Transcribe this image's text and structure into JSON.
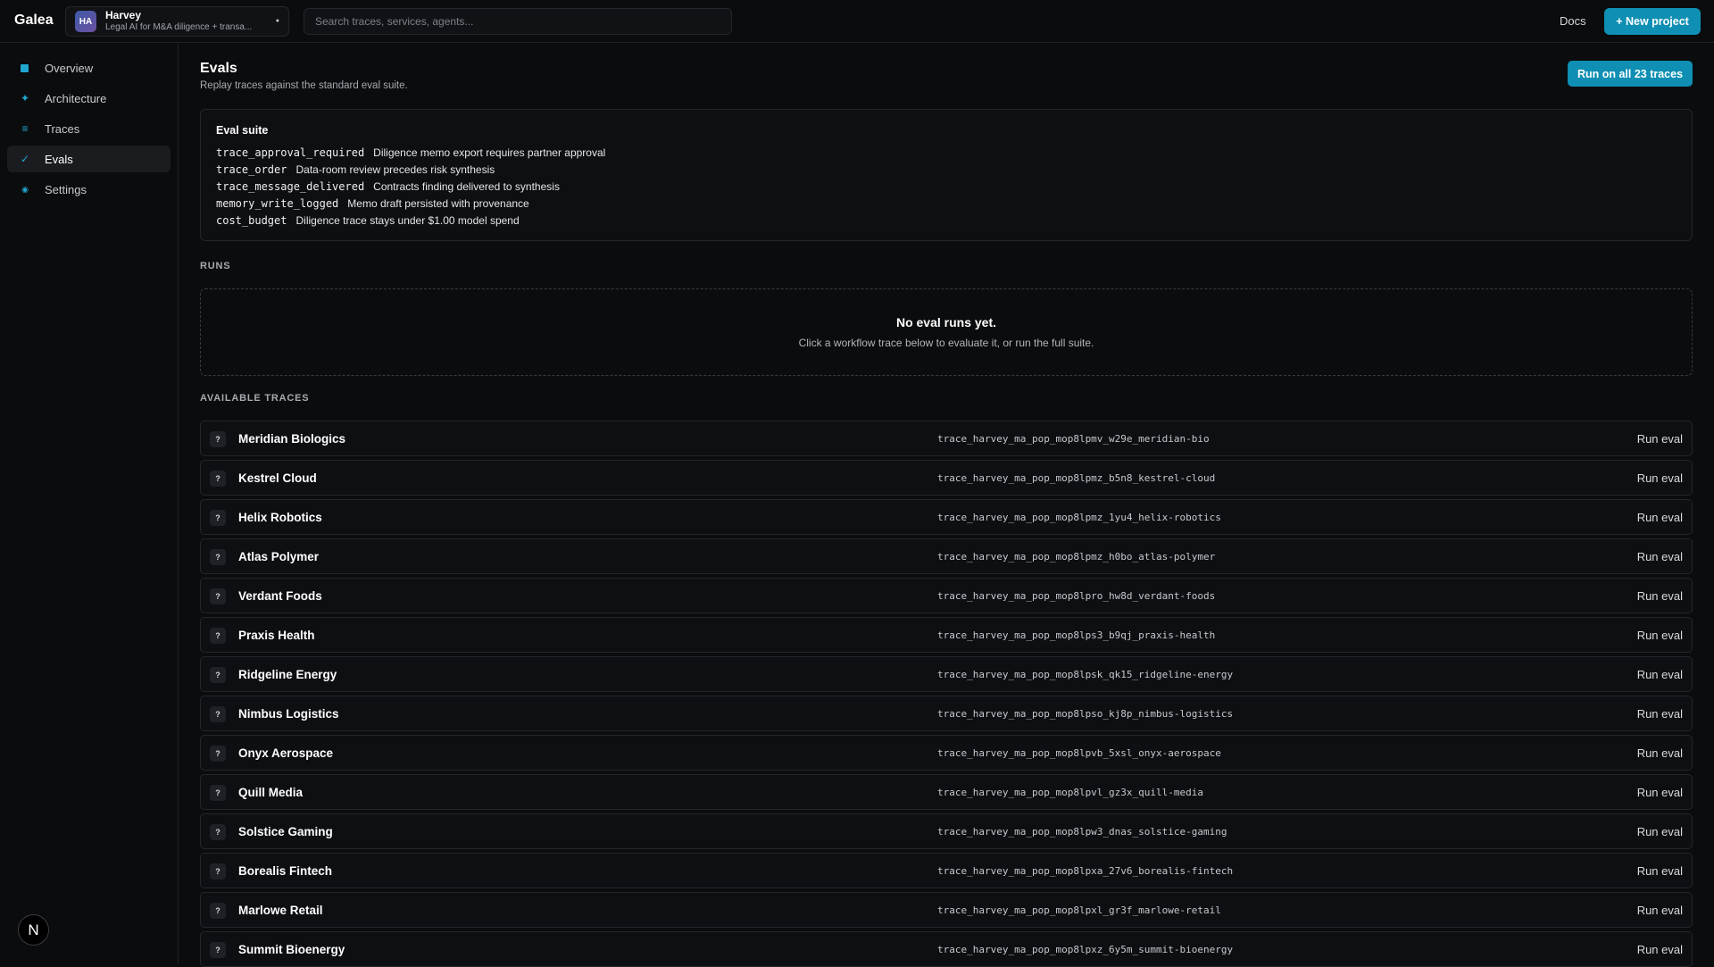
{
  "app": {
    "brand": "Galea"
  },
  "project": {
    "initials": "HA",
    "name": "Harvey",
    "description": "Legal AI for M&A diligence + transa..."
  },
  "search": {
    "placeholder": "Search traces, services, agents..."
  },
  "header": {
    "docs_label": "Docs",
    "new_project_label": "+ New project"
  },
  "sidebar": {
    "items": [
      {
        "label": "Overview",
        "icon": "square-icon"
      },
      {
        "label": "Architecture",
        "icon": "sparkle-icon"
      },
      {
        "label": "Traces",
        "icon": "list-icon"
      },
      {
        "label": "Evals",
        "icon": "check-icon",
        "active": true
      },
      {
        "label": "Settings",
        "icon": "gear-icon"
      }
    ],
    "footer_badge": "N"
  },
  "page": {
    "title": "Evals",
    "subtitle": "Replay traces against the standard eval suite.",
    "run_all_label": "Run on all 23 traces"
  },
  "suite": {
    "title": "Eval suite",
    "checks": [
      {
        "key": "trace_approval_required",
        "desc": "Diligence memo export requires partner approval"
      },
      {
        "key": "trace_order",
        "desc": "Data-room review precedes risk synthesis"
      },
      {
        "key": "trace_message_delivered",
        "desc": "Contracts finding delivered to synthesis"
      },
      {
        "key": "memory_write_logged",
        "desc": "Memo draft persisted with provenance"
      },
      {
        "key": "cost_budget",
        "desc": "Diligence trace stays under $1.00 model spend"
      }
    ]
  },
  "runs": {
    "label": "RUNS",
    "empty_title": "No eval runs yet.",
    "empty_sub": "Click a workflow trace below to evaluate it, or run the full suite."
  },
  "traces": {
    "label": "AVAILABLE TRACES",
    "status_glyph": "?",
    "action_label": "Run eval",
    "rows": [
      {
        "name": "Meridian Biologics",
        "id": "trace_harvey_ma_pop_mop8lpmv_w29e_meridian-bio"
      },
      {
        "name": "Kestrel Cloud",
        "id": "trace_harvey_ma_pop_mop8lpmz_b5n8_kestrel-cloud"
      },
      {
        "name": "Helix Robotics",
        "id": "trace_harvey_ma_pop_mop8lpmz_1yu4_helix-robotics"
      },
      {
        "name": "Atlas Polymer",
        "id": "trace_harvey_ma_pop_mop8lpmz_h0bo_atlas-polymer"
      },
      {
        "name": "Verdant Foods",
        "id": "trace_harvey_ma_pop_mop8lpro_hw8d_verdant-foods"
      },
      {
        "name": "Praxis Health",
        "id": "trace_harvey_ma_pop_mop8lps3_b9qj_praxis-health"
      },
      {
        "name": "Ridgeline Energy",
        "id": "trace_harvey_ma_pop_mop8lpsk_qk15_ridgeline-energy"
      },
      {
        "name": "Nimbus Logistics",
        "id": "trace_harvey_ma_pop_mop8lpso_kj8p_nimbus-logistics"
      },
      {
        "name": "Onyx Aerospace",
        "id": "trace_harvey_ma_pop_mop8lpvb_5xsl_onyx-aerospace"
      },
      {
        "name": "Quill Media",
        "id": "trace_harvey_ma_pop_mop8lpvl_gz3x_quill-media"
      },
      {
        "name": "Solstice Gaming",
        "id": "trace_harvey_ma_pop_mop8lpw3_dnas_solstice-gaming"
      },
      {
        "name": "Borealis Fintech",
        "id": "trace_harvey_ma_pop_mop8lpxa_27v6_borealis-fintech"
      },
      {
        "name": "Marlowe Retail",
        "id": "trace_harvey_ma_pop_mop8lpxl_gr3f_marlowe-retail"
      },
      {
        "name": "Summit Bioenergy",
        "id": "trace_harvey_ma_pop_mop8lpxz_6y5m_summit-bioenergy"
      }
    ]
  },
  "colors": {
    "accent": "#0e8fb3",
    "background": "#0b0c0e",
    "card": "#0e0f12",
    "border": "#24262c"
  }
}
